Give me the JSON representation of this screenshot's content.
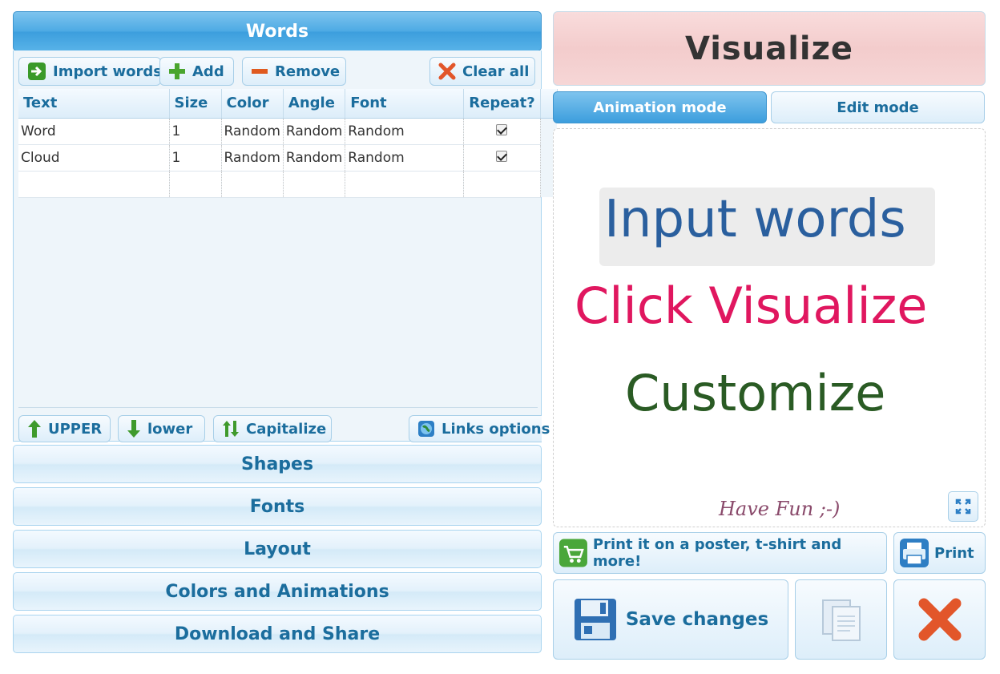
{
  "words_section": {
    "title": "Words",
    "toolbar": {
      "import_label": "Import words",
      "add_label": "Add",
      "remove_label": "Remove",
      "clear_label": "Clear all"
    },
    "columns": [
      "Text",
      "Size",
      "Color",
      "Angle",
      "Font",
      "Repeat?"
    ],
    "rows": [
      {
        "text": "Word",
        "size": "1",
        "color": "Random",
        "angle": "Random",
        "font": "Random",
        "repeat": true
      },
      {
        "text": "Cloud",
        "size": "1",
        "color": "Random",
        "angle": "Random",
        "font": "Random",
        "repeat": true
      }
    ],
    "case_buttons": {
      "upper_label": "UPPER",
      "lower_label": "lower",
      "capitalize_label": "Capitalize",
      "links_label": "Links options"
    }
  },
  "accordion": {
    "shapes": "Shapes",
    "fonts": "Fonts",
    "layout": "Layout",
    "colors": "Colors and Animations",
    "download": "Download and Share"
  },
  "visualize": {
    "title": "Visualize",
    "animation_mode": "Animation mode",
    "edit_mode": "Edit mode"
  },
  "canvas": {
    "line1": "Input words",
    "line2": "Click Visualize",
    "line3": "Customize",
    "footer": "Have Fun ;-)",
    "colors": {
      "line1": "#2a5f9e",
      "line2": "#e0175f",
      "line3": "#2a5b24",
      "footer": "#8a4a6b"
    }
  },
  "actions": {
    "print_poster": "Print it on a poster, t-shirt and more!",
    "print": "Print",
    "save": "Save changes"
  },
  "icons": [
    "import-icon",
    "plus-icon",
    "minus-icon",
    "clear-x-icon",
    "arrow-up-icon",
    "arrow-down-icon",
    "swap-arrows-icon",
    "globe-icon",
    "fullscreen-icon",
    "cart-icon",
    "printer-icon",
    "floppy-icon",
    "copy-icon",
    "close-x-icon"
  ]
}
